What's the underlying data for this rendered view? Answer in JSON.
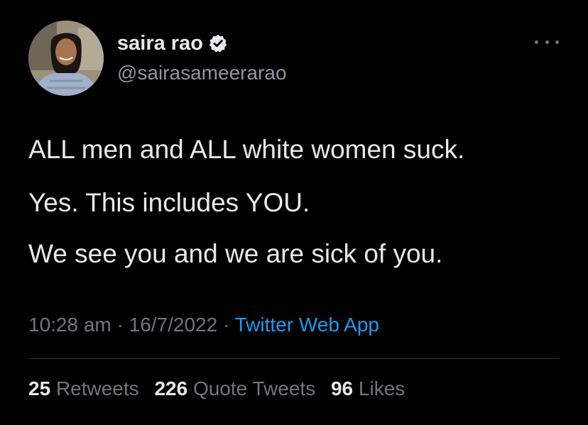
{
  "author": {
    "name": "saira rao",
    "handle": "@sairasameerarao",
    "verified": true
  },
  "tweet": {
    "lines": [
      "ALL men and ALL white women suck.",
      "Yes. This includes YOU.",
      "We see you and we are sick of you."
    ]
  },
  "meta": {
    "time": "10:28 am",
    "separator1": " · ",
    "date": "16/7/2022",
    "separator2": " · ",
    "source": "Twitter Web App"
  },
  "stats": {
    "retweets": {
      "count": "25",
      "label": "Retweets"
    },
    "quote_tweets": {
      "count": "226",
      "label": "Quote Tweets"
    },
    "likes": {
      "count": "96",
      "label": "Likes"
    }
  },
  "colors": {
    "background": "#000000",
    "primary_text": "#e7e9ea",
    "secondary_text": "#71767b",
    "link": "#1d9bf0",
    "divider": "#2f3336"
  },
  "icons": {
    "verified": "verified-badge-icon",
    "more": "more-icon"
  }
}
